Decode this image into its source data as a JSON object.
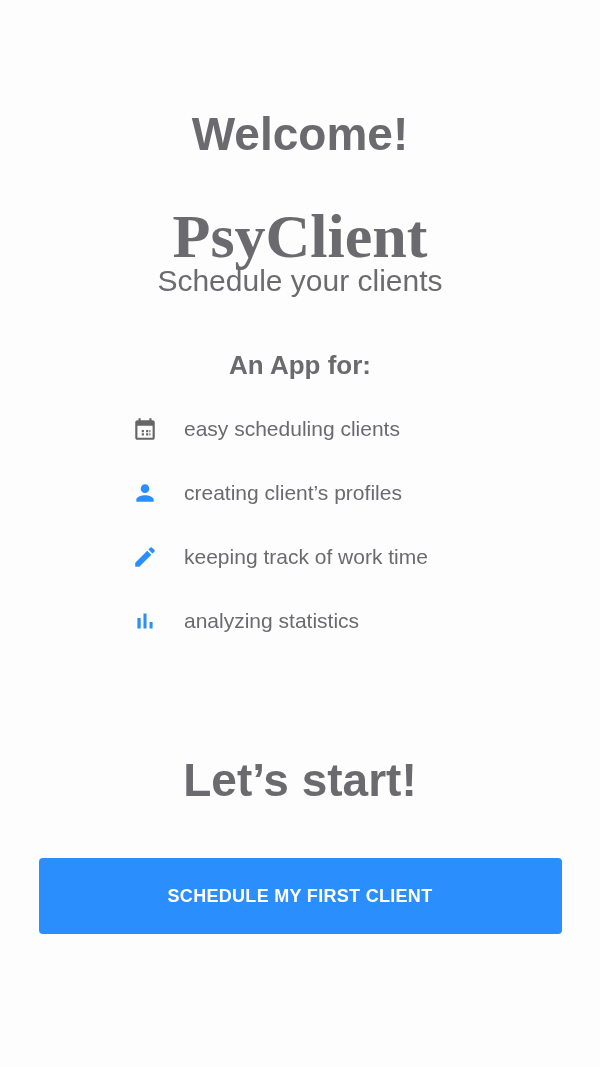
{
  "welcome": "Welcome!",
  "app_name": "PsyClient",
  "tagline": "Schedule your clients",
  "features_heading": "An App for:",
  "features": [
    {
      "kind": "calendar",
      "color": "#666666",
      "label": "easy scheduling clients"
    },
    {
      "kind": "person",
      "color": "#2a8ffc",
      "label": "creating client’s profiles"
    },
    {
      "kind": "pencil",
      "color": "#2a8ffc",
      "label": "keeping track of work time"
    },
    {
      "kind": "chart",
      "color": "#2a8ffc",
      "label": "analyzing statistics"
    }
  ],
  "cta_heading": "Let’s start!",
  "button": "SCHEDULE MY FIRST CLIENT"
}
